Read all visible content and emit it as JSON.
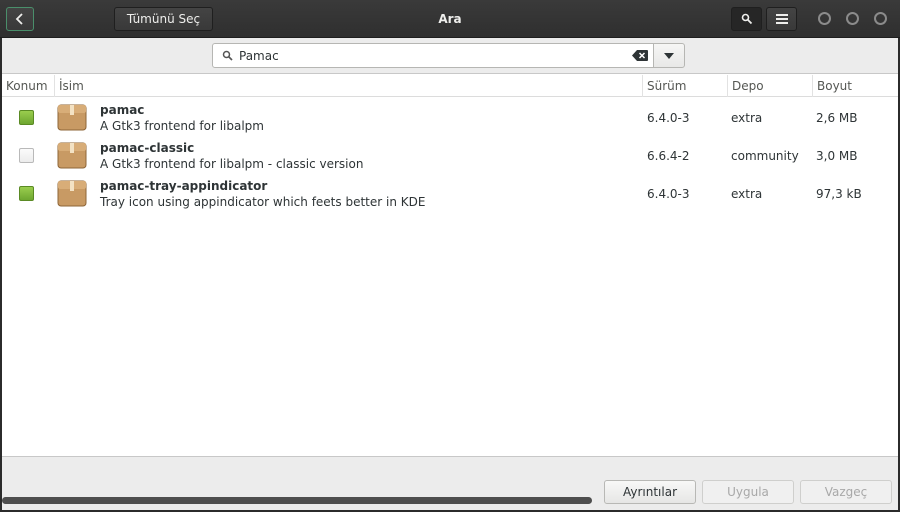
{
  "header": {
    "back_icon": "chevron-left-icon",
    "select_all_label": "Tümünü Seç",
    "title": "Ara",
    "search_toggle_icon": "search-icon",
    "menu_icon": "hamburger-menu-icon"
  },
  "search": {
    "value": "Pamac",
    "search_icon": "search-icon",
    "clear_icon": "clear-backspace-icon",
    "dropdown_icon": "caret-down-icon"
  },
  "columns": {
    "status": "Konum",
    "name": "İsim",
    "version": "Sürüm",
    "repo": "Depo",
    "size": "Boyut"
  },
  "packages": [
    {
      "name": "pamac",
      "description": "A Gtk3 frontend for libalpm",
      "version": "6.4.0-3",
      "repo": "extra",
      "size": "2,6 MB",
      "installed": true
    },
    {
      "name": "pamac-classic",
      "description": "A Gtk3 frontend for libalpm - classic version",
      "version": "6.6.4-2",
      "repo": "community",
      "size": "3,0 MB",
      "installed": false
    },
    {
      "name": "pamac-tray-appindicator",
      "description": "Tray icon using appindicator which feets better in KDE",
      "version": "6.4.0-3",
      "repo": "extra",
      "size": "97,3 kB",
      "installed": true
    }
  ],
  "footer": {
    "progress_fraction": 1.0,
    "details_label": "Ayrıntılar",
    "apply_label": "Uygula",
    "cancel_label": "Vazgeç"
  },
  "colors": {
    "installed": "#7cb83a",
    "headerbar": "#333333"
  }
}
